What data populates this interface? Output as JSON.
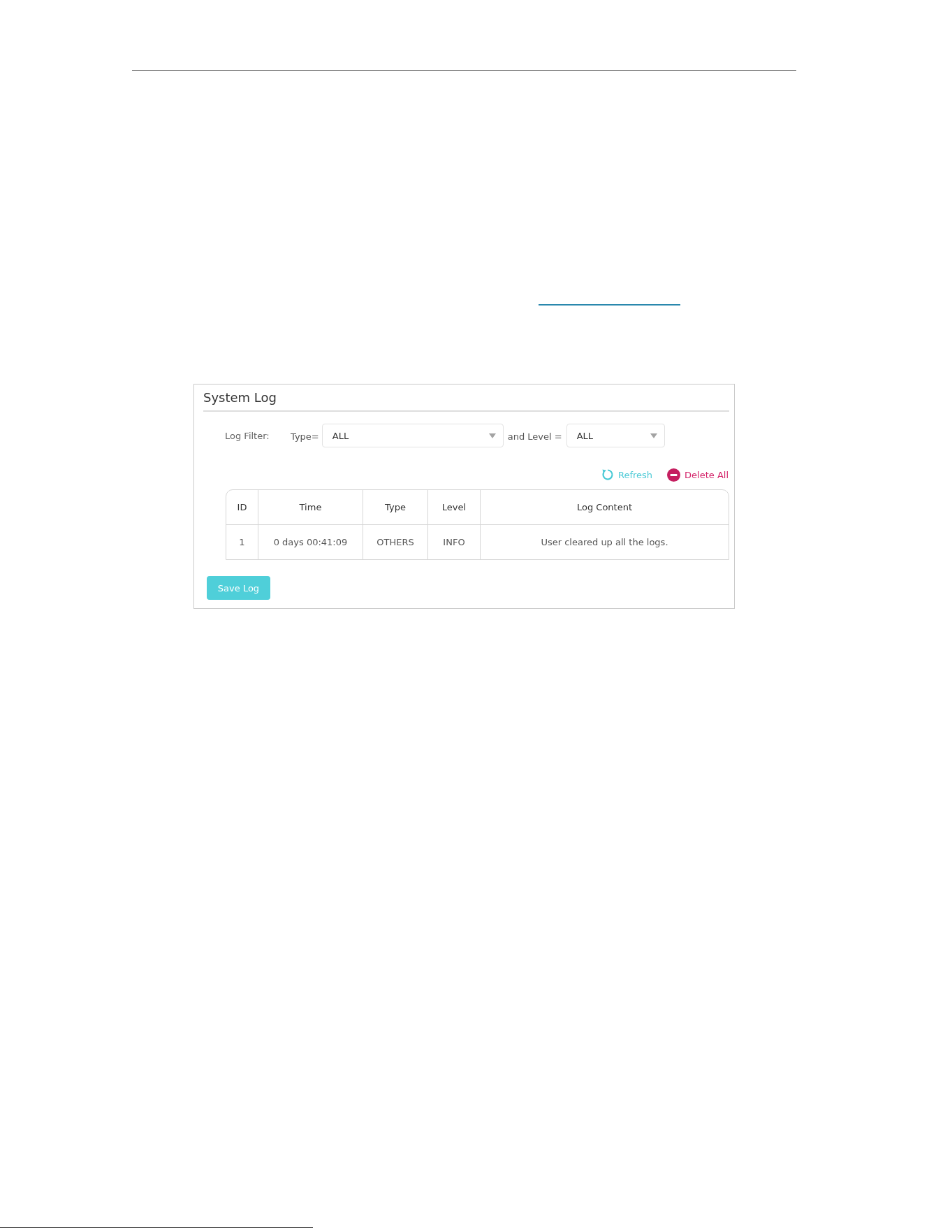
{
  "panel": {
    "title": "System Log"
  },
  "filter": {
    "label": "Log Filter:",
    "type_label": "Type=",
    "type_value": "ALL",
    "level_label": "and Level =",
    "level_value": "ALL"
  },
  "actions": [
    {
      "kind": "refresh",
      "label": "Refresh"
    },
    {
      "kind": "delete",
      "label": "Delete All"
    }
  ],
  "table": {
    "columns": [
      "ID",
      "Time",
      "Type",
      "Level",
      "Log Content"
    ],
    "rows": [
      [
        "1",
        "0 days 00:41:09",
        "OTHERS",
        "INFO",
        "User cleared up all the logs."
      ]
    ]
  },
  "save_button": {
    "label": "Save Log"
  }
}
